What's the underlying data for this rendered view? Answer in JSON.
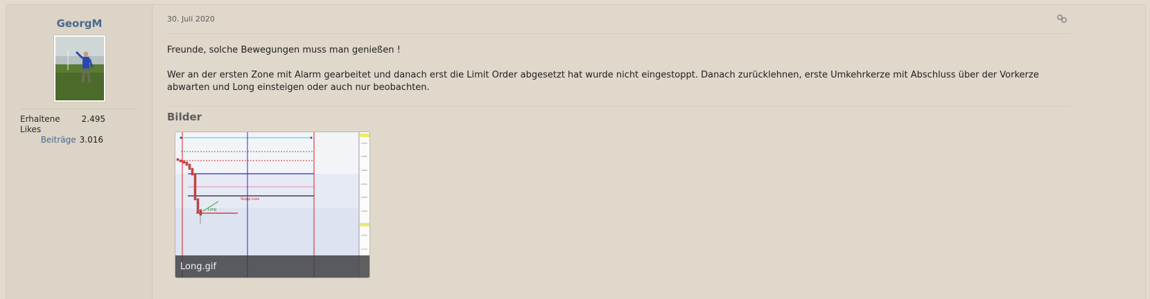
{
  "user": {
    "name": "GeorgM",
    "avatar_icon": "user-avatar-photo",
    "stats": [
      {
        "label": "Erhaltene Likes",
        "value": "2.495",
        "link": false
      },
      {
        "label": "Beiträge",
        "value": "3.016",
        "link": true
      }
    ]
  },
  "post": {
    "date": "30. Juli 2020",
    "permalink_icon": "link-icon",
    "paragraphs": [
      "Freunde, solche Bewegungen muss man genießen !",
      "Wer an der ersten Zone mit Alarm gearbeitet und danach erst die Limit Order abgesetzt hat wurde nicht eingestoppt. Danach zurücklehnen, erste Umkehrkerze mit Abschluss über der Vorkerze abwarten und Long einsteigen oder auch nur beobachten."
    ]
  },
  "attachments": {
    "title": "Bilder",
    "items": [
      {
        "filename": "Long.gif",
        "annotations": {
          "stop_loss": "Stopp Loss",
          "long": "Long"
        }
      }
    ]
  },
  "colors": {
    "username": "#47698f",
    "link": "#47698f",
    "background": "#e3dbce"
  }
}
